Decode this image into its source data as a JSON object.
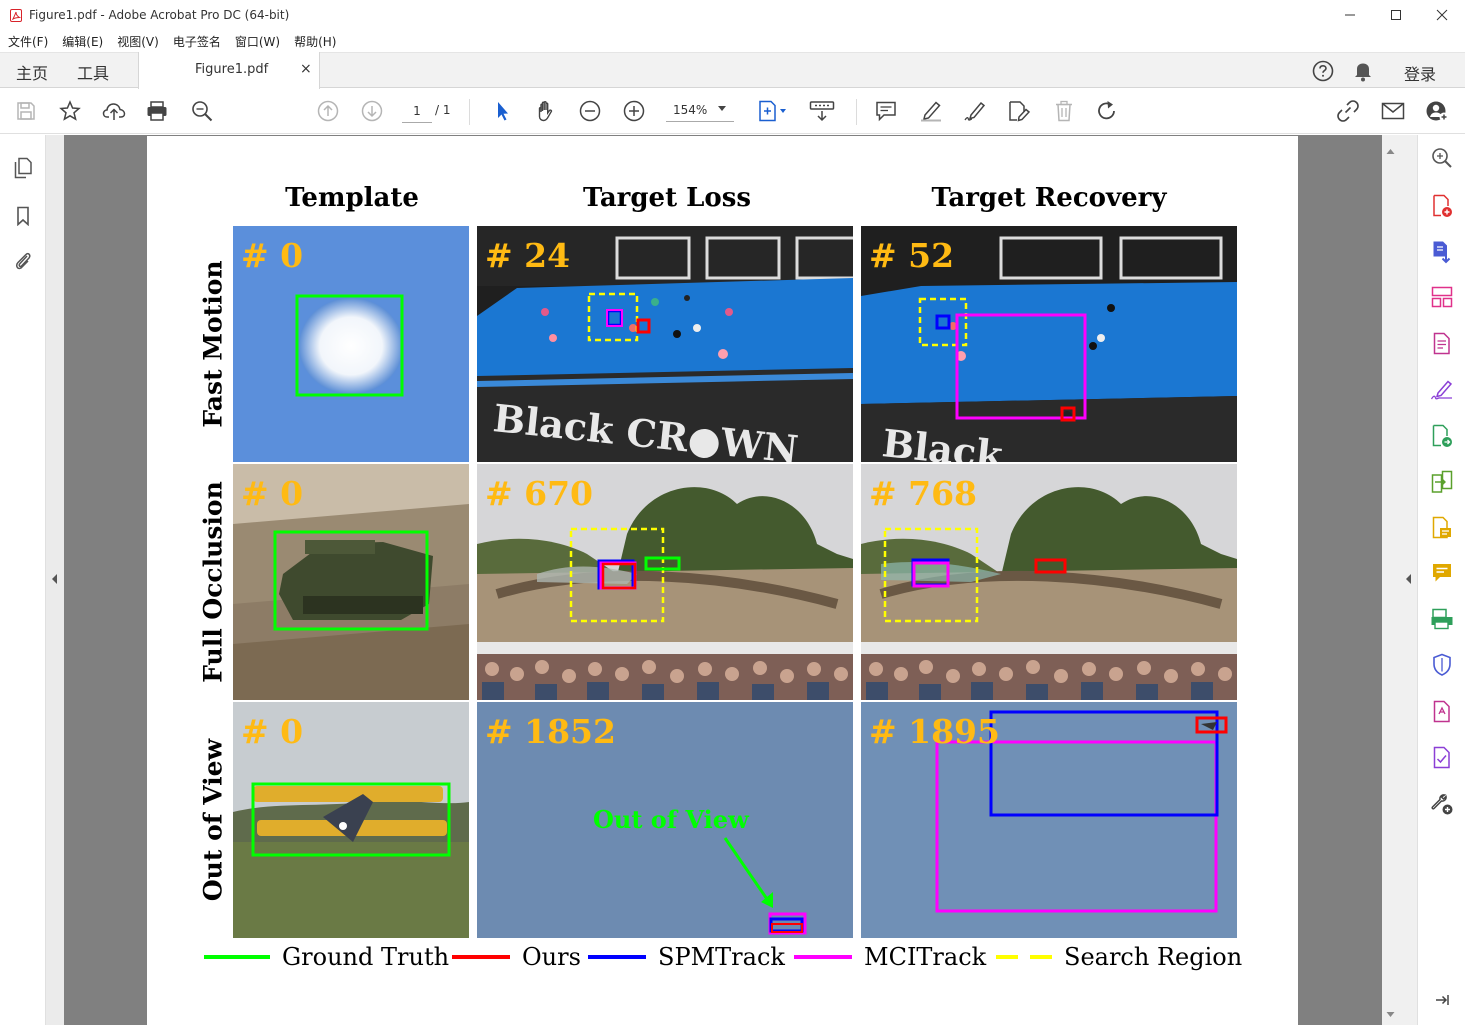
{
  "window": {
    "title": "Figure1.pdf - Adobe Acrobat Pro DC (64-bit)"
  },
  "menu": [
    "文件(F)",
    "编辑(E)",
    "视图(V)",
    "电子签名",
    "窗口(W)",
    "帮助(H)"
  ],
  "tabs": {
    "home": "主页",
    "tools": "工具",
    "document": "Figure1.pdf",
    "close": "×",
    "login": "登录"
  },
  "toolbar": {
    "page_current": "1",
    "page_total": "/ 1",
    "zoom": "154%"
  },
  "figure": {
    "columns": [
      "Template",
      "Target Loss",
      "Target Recovery"
    ],
    "rows": [
      "Fast Motion",
      "Full Occlusion",
      "Out of View"
    ],
    "frames": [
      [
        "# 0",
        "# 24",
        "# 52"
      ],
      [
        "# 0",
        "# 670",
        "# 768"
      ],
      [
        "# 0",
        "# 1852",
        "# 1895"
      ]
    ],
    "annotation": "Out of View",
    "legend": [
      {
        "label": "Ground Truth",
        "color": "#00ff00",
        "dashed": false
      },
      {
        "label": "Ours",
        "color": "#ff0000",
        "dashed": false
      },
      {
        "label": "SPMTrack",
        "color": "#0000ff",
        "dashed": false
      },
      {
        "label": "MCITrack",
        "color": "#ff00ff",
        "dashed": false
      },
      {
        "label": "Search Region",
        "color": "#ffff00",
        "dashed": true
      }
    ]
  }
}
